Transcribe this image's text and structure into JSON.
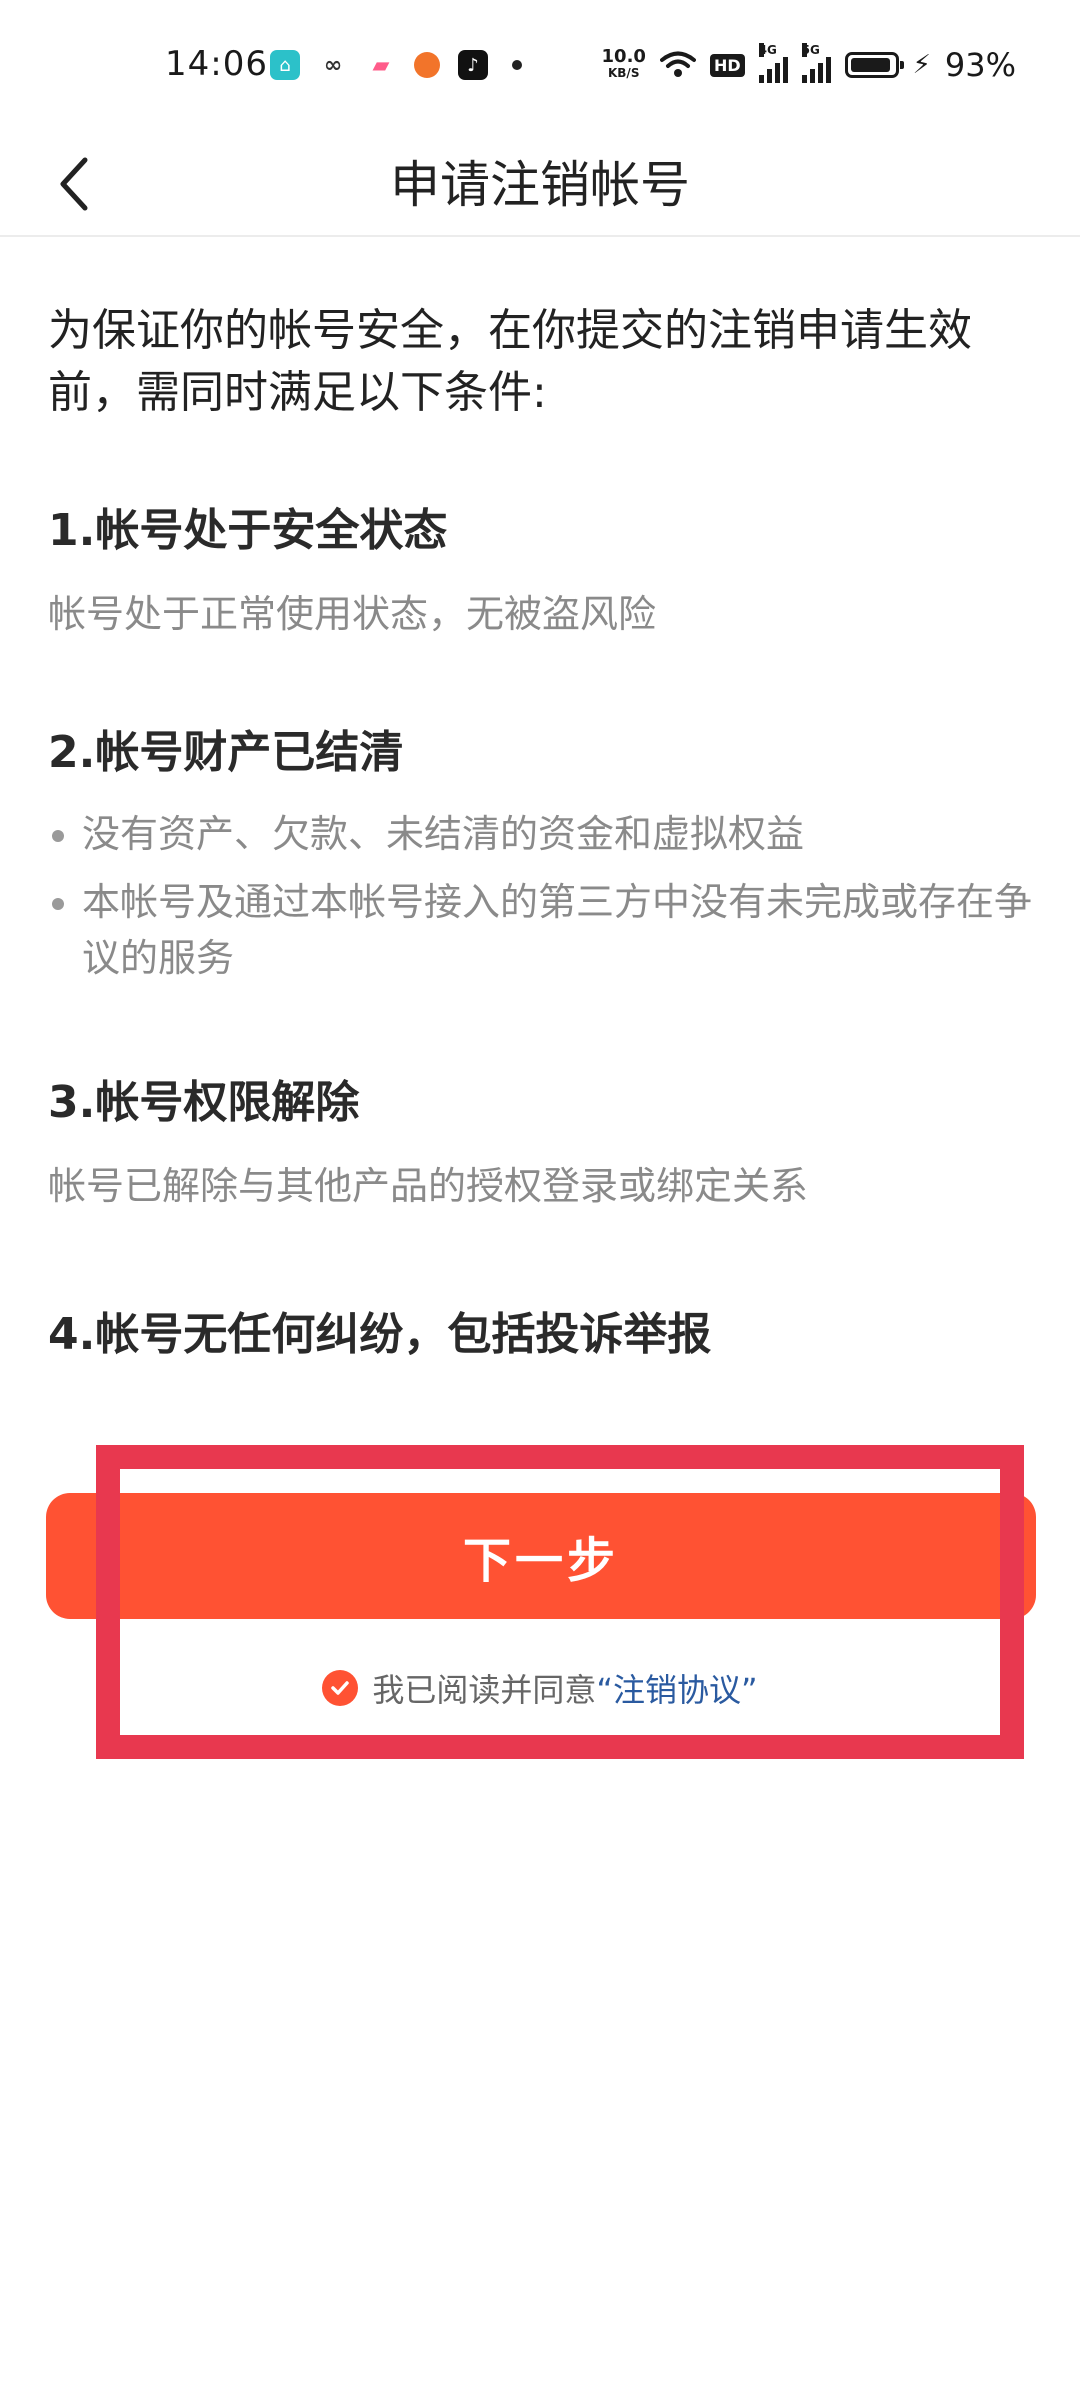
{
  "status_bar": {
    "time": "14:06",
    "net_speed_value": "10.0",
    "net_speed_unit": "KB/S",
    "hd_label": "HD",
    "sim1_gen": "4G",
    "sim2_gen": "5G",
    "battery_percent": "93%",
    "battery_level": 0.93
  },
  "nav": {
    "title": "申请注销帐号"
  },
  "intro": "为保证你的帐号安全，在你提交的注销申请生效前，需同时满足以下条件:",
  "conditions": [
    {
      "title": "1.帐号处于安全状态",
      "desc": "帐号处于正常使用状态，无被盗风险"
    },
    {
      "title": "2.帐号财产已结清",
      "bullets": [
        "没有资产、欠款、未结清的资金和虚拟权益",
        "本帐号及通过本帐号接入的第三方中没有未完成或存在争议的服务"
      ]
    },
    {
      "title": "3.帐号权限解除",
      "desc": "帐号已解除与其他产品的授权登录或绑定关系"
    },
    {
      "title": "4.帐号无任何纠纷，包括投诉举报"
    }
  ],
  "next_button_label": "下一步",
  "agreement": {
    "text": "我已阅读并同意",
    "link": "“注销协议”",
    "checked": true
  },
  "colors": {
    "accent": "#ff5233",
    "link": "#2a5aa0",
    "highlight": "#e8384f"
  }
}
